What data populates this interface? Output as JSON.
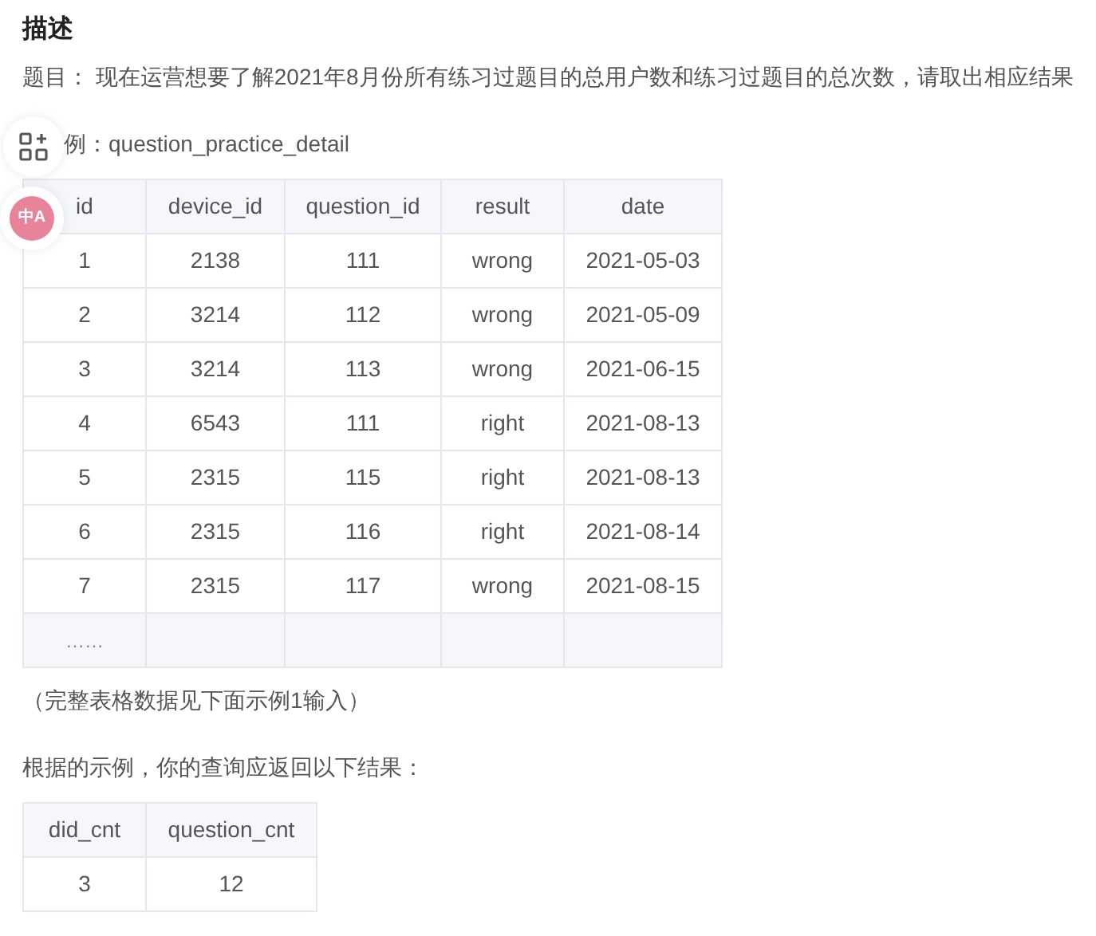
{
  "heading": "描述",
  "question": {
    "label": "题目：",
    "text": "现在运营想要了解2021年8月份所有练习过题目的总用户数和练习过题目的总次数，请取出相应结果"
  },
  "example_caption": "例：question_practice_detail",
  "floating_tools": [
    {
      "kind": "grid"
    },
    {
      "kind": "translate",
      "label": "中A"
    }
  ],
  "table": {
    "columns": [
      "id",
      "device_id",
      "question_id",
      "result",
      "date"
    ],
    "rows": [
      {
        "kind": "data",
        "cells": [
          "1",
          "2138",
          "111",
          "wrong",
          "2021-05-03"
        ]
      },
      {
        "kind": "data",
        "cells": [
          "2",
          "3214",
          "112",
          "wrong",
          "2021-05-09"
        ]
      },
      {
        "kind": "data",
        "cells": [
          "3",
          "3214",
          "113",
          "wrong",
          "2021-06-15"
        ]
      },
      {
        "kind": "data",
        "cells": [
          "4",
          "6543",
          "111",
          "right",
          "2021-08-13"
        ]
      },
      {
        "kind": "data",
        "cells": [
          "5",
          "2315",
          "115",
          "right",
          "2021-08-13"
        ]
      },
      {
        "kind": "data",
        "cells": [
          "6",
          "2315",
          "116",
          "right",
          "2021-08-14"
        ]
      },
      {
        "kind": "data",
        "cells": [
          "7",
          "2315",
          "117",
          "wrong",
          "2021-08-15"
        ]
      },
      {
        "kind": "ellipsis",
        "cells": [
          "……"
        ]
      }
    ]
  },
  "table_note": "（完整表格数据见下面示例1输入）",
  "result_intro": "根据的示例，你的查询应返回以下结果：",
  "result_table": {
    "columns": [
      "did_cnt",
      "question_cnt"
    ],
    "rows": [
      {
        "kind": "data",
        "cells": [
          "3",
          "12"
        ]
      }
    ]
  }
}
